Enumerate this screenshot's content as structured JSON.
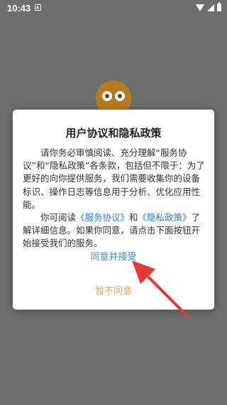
{
  "status_bar": {
    "time": "10:43"
  },
  "dialog": {
    "title": "用户协议和隐私政策",
    "paragraph1": "请你务必审慎阅读、充分理解“服务协议”和“隐私政策”各条款，包括但不限于：为了更好的向你提供服务，我们需要收集你的设备标识、操作日志等信息用于分析、优化应用性能。",
    "paragraph2": {
      "pre": "你可阅读",
      "link1": "《服务协议》",
      "mid": "和",
      "link2": "《隐私政策》",
      "post": "了解详细信息。如果你同意，请点击下面按钮开始接受我们的服务。"
    },
    "agree_label": "同意并接受",
    "decline_label": "暂不同意"
  },
  "colors": {
    "accent": "#3a8bd6",
    "decline": "#f0a23c",
    "arrow": "#e53935",
    "overlay": "#6e6e6e"
  },
  "icons": [
    "notification-icon",
    "wifi-icon",
    "signal-icon",
    "battery-icon",
    "app-logo-icon",
    "annotation-arrow-icon"
  ]
}
